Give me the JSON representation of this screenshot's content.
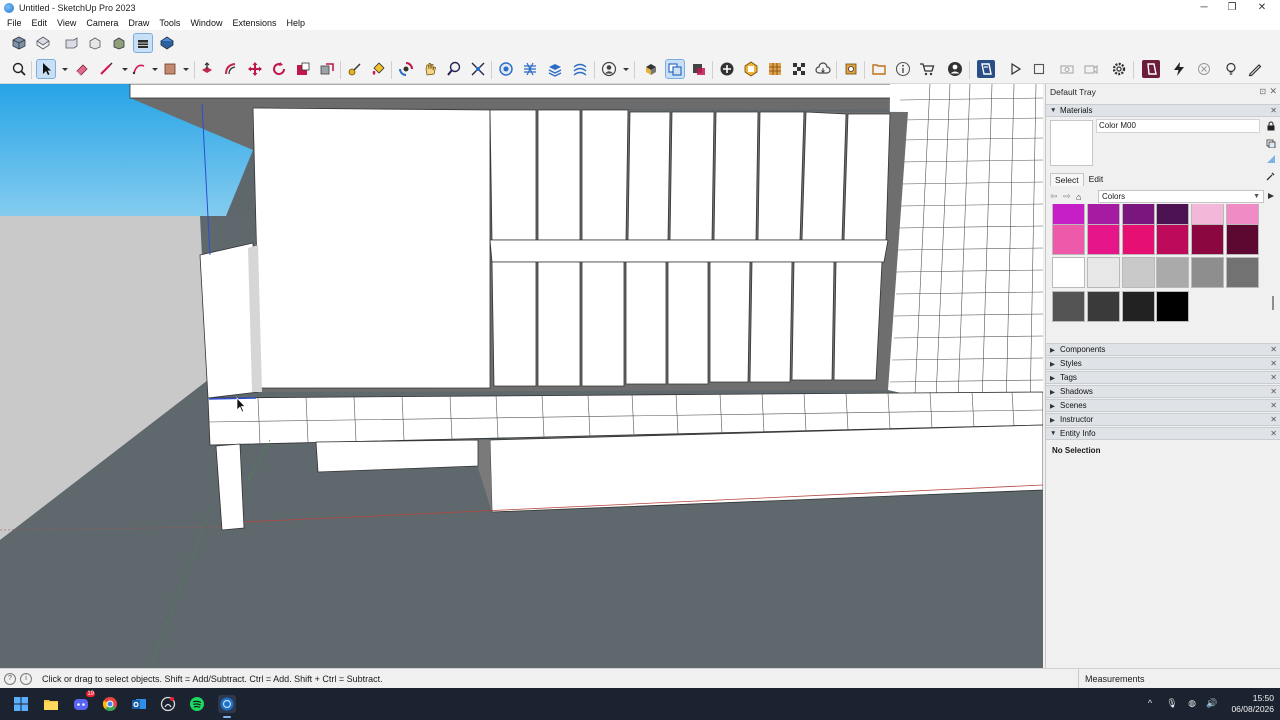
{
  "window": {
    "title": "Untitled - SketchUp Pro 2023",
    "minimize": "─",
    "maximize": "❐",
    "close": "✕"
  },
  "menu": [
    "File",
    "Edit",
    "View",
    "Camera",
    "Draw",
    "Tools",
    "Window",
    "Extensions",
    "Help"
  ],
  "toolbar_primary": [
    {
      "name": "iso-view-icon"
    },
    {
      "name": "top-view-icon"
    },
    {
      "name": "front-view-icon"
    },
    {
      "name": "right-view-icon"
    },
    {
      "name": "back-view-icon"
    },
    {
      "name": "left-view-icon"
    },
    {
      "name": "bottom-view-icon"
    }
  ],
  "toolbar_secondary": [
    "zoom-extents-icon",
    "select-icon",
    "eraser-icon",
    "line-icon",
    "arc-icon",
    "shape-icon",
    "push-pull-icon",
    "offset-icon",
    "move-icon",
    "rotate-icon",
    "scale-icon",
    "tape-measure-icon",
    "paint-bucket-icon",
    "orbit-icon",
    "pan-icon",
    "zoom-icon",
    "zoom-window-icon",
    "section-plane-icon",
    "sandbox-icon",
    "layers-icon",
    "warehouse-icon",
    "account-icon",
    "components-icon",
    "groups-icon",
    "solid-tools-icon",
    "add-location-icon",
    "photo-texture-icon",
    "extension-warehouse-icon",
    "outliner-icon",
    "cloud-icon",
    "settings-icon",
    "folder-icon",
    "instructor-icon",
    "cart-icon",
    "profile-icon",
    "trimble-icon",
    "play-icon",
    "stop-icon",
    "camera-icon",
    "video-icon",
    "gear-icon",
    "brand-icon",
    "lightning-icon",
    "close-circle-icon",
    "bulb-icon",
    "pencil-icon"
  ],
  "tray": {
    "title": "Default Tray",
    "pin": "⊡",
    "close": "✕",
    "materials": {
      "label": "Materials",
      "name": "Color M00",
      "tabs": [
        "Select",
        "Edit"
      ],
      "collection": "Colors",
      "swatch_rows": [
        [
          "#c71fc7",
          "#a51ca3",
          "#7a167d",
          "#4c1150",
          "#f2b7d9",
          "#f08bc6"
        ],
        [
          "#ec5aa9",
          "#e6168a",
          "#e60f72",
          "#be0a5a",
          "#8a083f",
          "#5c0830"
        ],
        [
          "#ffffff",
          "#e7e7e7",
          "#c9c9c9",
          "#aaaaaa",
          "#8e8e8e",
          "#727272"
        ],
        [
          "#545454",
          "#3a3a3a",
          "#222222",
          "#000000"
        ]
      ]
    },
    "panels": [
      "Components",
      "Styles",
      "Tags",
      "Shadows",
      "Scenes",
      "Instructor",
      "Entity Info"
    ],
    "entity_info": "No Selection"
  },
  "status": {
    "message": "Click or drag to select objects. Shift = Add/Subtract. Ctrl = Add. Shift + Ctrl = Subtract.",
    "measurements_label": "Measurements"
  },
  "taskbar": {
    "apps": [
      "windows-start-icon",
      "file-explorer-icon",
      "discord-icon",
      "chrome-icon",
      "outlook-icon",
      "github-icon",
      "spotify-icon",
      "sketchup-icon"
    ],
    "badge": "19",
    "time": "15:50",
    "date": "06/08/2026"
  }
}
